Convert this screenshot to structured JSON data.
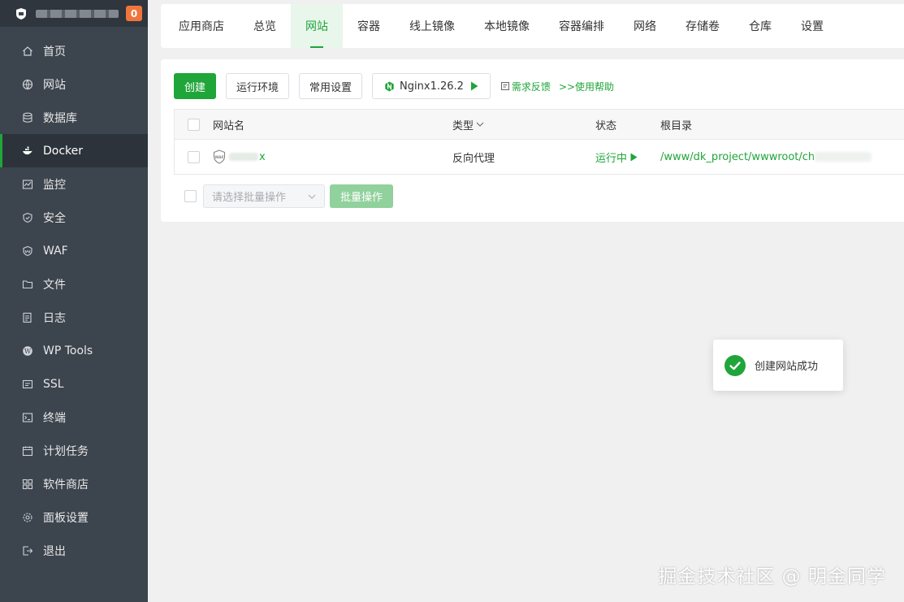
{
  "sidebar": {
    "brand_badge": "0",
    "items": [
      {
        "label": "首页",
        "icon": "home-icon"
      },
      {
        "label": "网站",
        "icon": "globe-icon"
      },
      {
        "label": "数据库",
        "icon": "database-icon"
      },
      {
        "label": "Docker",
        "icon": "docker-icon",
        "active": true
      },
      {
        "label": "监控",
        "icon": "monitor-icon"
      },
      {
        "label": "安全",
        "icon": "shield-icon"
      },
      {
        "label": "WAF",
        "icon": "waf-shield-icon"
      },
      {
        "label": "文件",
        "icon": "folder-icon"
      },
      {
        "label": "日志",
        "icon": "log-icon"
      },
      {
        "label": "WP Tools",
        "icon": "wordpress-icon"
      },
      {
        "label": "SSL",
        "icon": "ssl-icon"
      },
      {
        "label": "终端",
        "icon": "terminal-icon"
      },
      {
        "label": "计划任务",
        "icon": "calendar-icon"
      },
      {
        "label": "软件商店",
        "icon": "apps-icon"
      },
      {
        "label": "面板设置",
        "icon": "gear-icon"
      },
      {
        "label": "退出",
        "icon": "logout-icon"
      }
    ]
  },
  "tabs": [
    "应用商店",
    "总览",
    "网站",
    "容器",
    "线上镜像",
    "本地镜像",
    "容器编排",
    "网络",
    "存储卷",
    "仓库",
    "设置"
  ],
  "active_tab": "网站",
  "toolbar": {
    "create": "创建",
    "runtime_env": "运行环境",
    "common_settings": "常用设置",
    "nginx_version": "Nginx1.26.2",
    "feedback": "需求反馈",
    "help": ">>使用帮助"
  },
  "table": {
    "headers": {
      "name": "网站名",
      "type": "类型",
      "status": "状态",
      "root": "根目录"
    },
    "rows": [
      {
        "name_suffix": "x",
        "type": "反向代理",
        "status": "运行中",
        "root": "/www/dk_project/wwwroot/ch"
      }
    ]
  },
  "batch": {
    "select_placeholder": "请选择批量操作",
    "button": "批量操作"
  },
  "toast": {
    "message": "创建网站成功"
  },
  "watermark": "掘金技术社区 @ 明金同学",
  "colors": {
    "accent": "#20a53a",
    "sidebar_bg": "#3c444d",
    "badge": "#f0753c"
  }
}
